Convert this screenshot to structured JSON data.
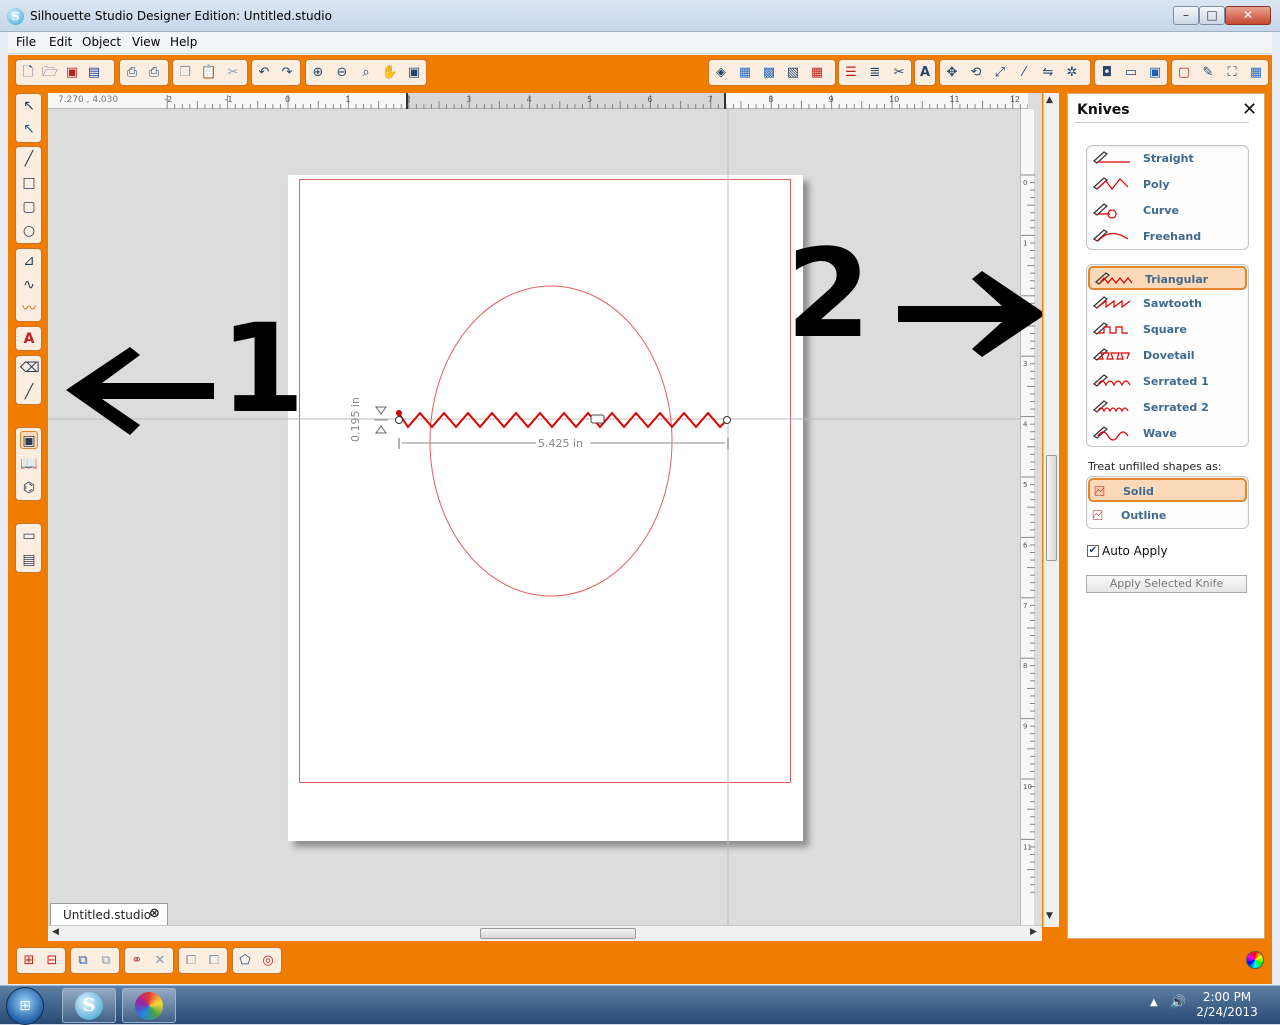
{
  "window": {
    "title": "Silhouette Studio Designer Edition: Untitled.studio"
  },
  "menu": [
    "File",
    "Edit",
    "Object",
    "View",
    "Help"
  ],
  "canvas": {
    "coord_readout": "7.270 , 4.030",
    "height_dim": "0.195 in",
    "width_dim": "5.425 in",
    "ruler_top_labels": [
      "-2",
      "-1",
      "0",
      "1",
      "2",
      "3",
      "4",
      "5",
      "6",
      "7",
      "8",
      "9",
      "10",
      "11",
      "12"
    ],
    "ruler_right_labels": [
      "0",
      "1",
      "2",
      "3",
      "4",
      "5",
      "6",
      "7",
      "8",
      "9",
      "10",
      "11"
    ],
    "annotation_left": "1",
    "annotation_right": "2"
  },
  "document_tab": {
    "label": "Untitled.studio"
  },
  "panel": {
    "title": "Knives",
    "knives_basic": [
      "Straight",
      "Poly",
      "Curve",
      "Freehand"
    ],
    "knives_pattern": [
      "Triangular",
      "Sawtooth",
      "Square",
      "Dovetail",
      "Serrated 1",
      "Serrated 2",
      "Wave"
    ],
    "selected_knife": "Triangular",
    "treat_label": "Treat unfilled shapes as:",
    "treat_options": [
      "Solid",
      "Outline"
    ],
    "selected_treat": "Solid",
    "auto_apply_label": "Auto Apply",
    "auto_apply_checked": true,
    "apply_button": "Apply Selected Knife"
  },
  "taskbar": {
    "time": "2:00 PM",
    "date": "2/24/2013"
  },
  "colors": {
    "accent": "#f07d00",
    "cut_line": "#e36060",
    "selection": "#fbd9b9"
  }
}
